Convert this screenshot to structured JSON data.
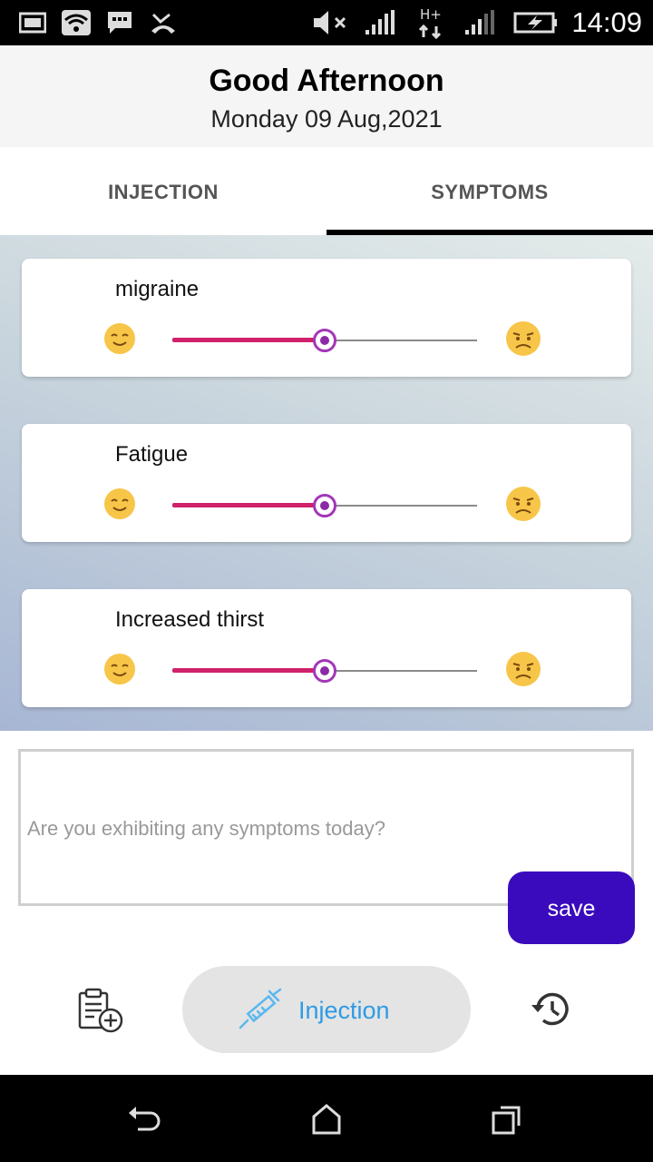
{
  "status_bar": {
    "time": "14:09",
    "icons": [
      "notification-image-icon",
      "wifi-icon",
      "message-icon",
      "missed-call-icon",
      "mute-icon",
      "signal-icon",
      "data-h-plus-icon",
      "signal-icon",
      "battery-charging-icon"
    ]
  },
  "header": {
    "greeting": "Good Afternoon",
    "date": "Monday 09 Aug,2021"
  },
  "tabs": [
    {
      "label": "INJECTION",
      "selected": false
    },
    {
      "label": "SYMPTOMS",
      "selected": true
    }
  ],
  "symptoms": [
    {
      "label": "migraine",
      "level": 0.5
    },
    {
      "label": "Fatigue",
      "level": 0.5
    },
    {
      "label": "Increased thirst",
      "level": 0.5
    }
  ],
  "notes": {
    "placeholder": "Are you exhibiting any symptoms today?",
    "value": ""
  },
  "save_label": "save",
  "bottom_nav": {
    "left_icon": "clipboard-add-icon",
    "center_label": "Injection",
    "center_icon": "syringe-icon",
    "right_icon": "history-icon"
  },
  "colors": {
    "accent": "#3a0bbd",
    "slider_active": "#d0216a",
    "slider_thumb": "#a336b8",
    "nav_label": "#2e9be6"
  }
}
